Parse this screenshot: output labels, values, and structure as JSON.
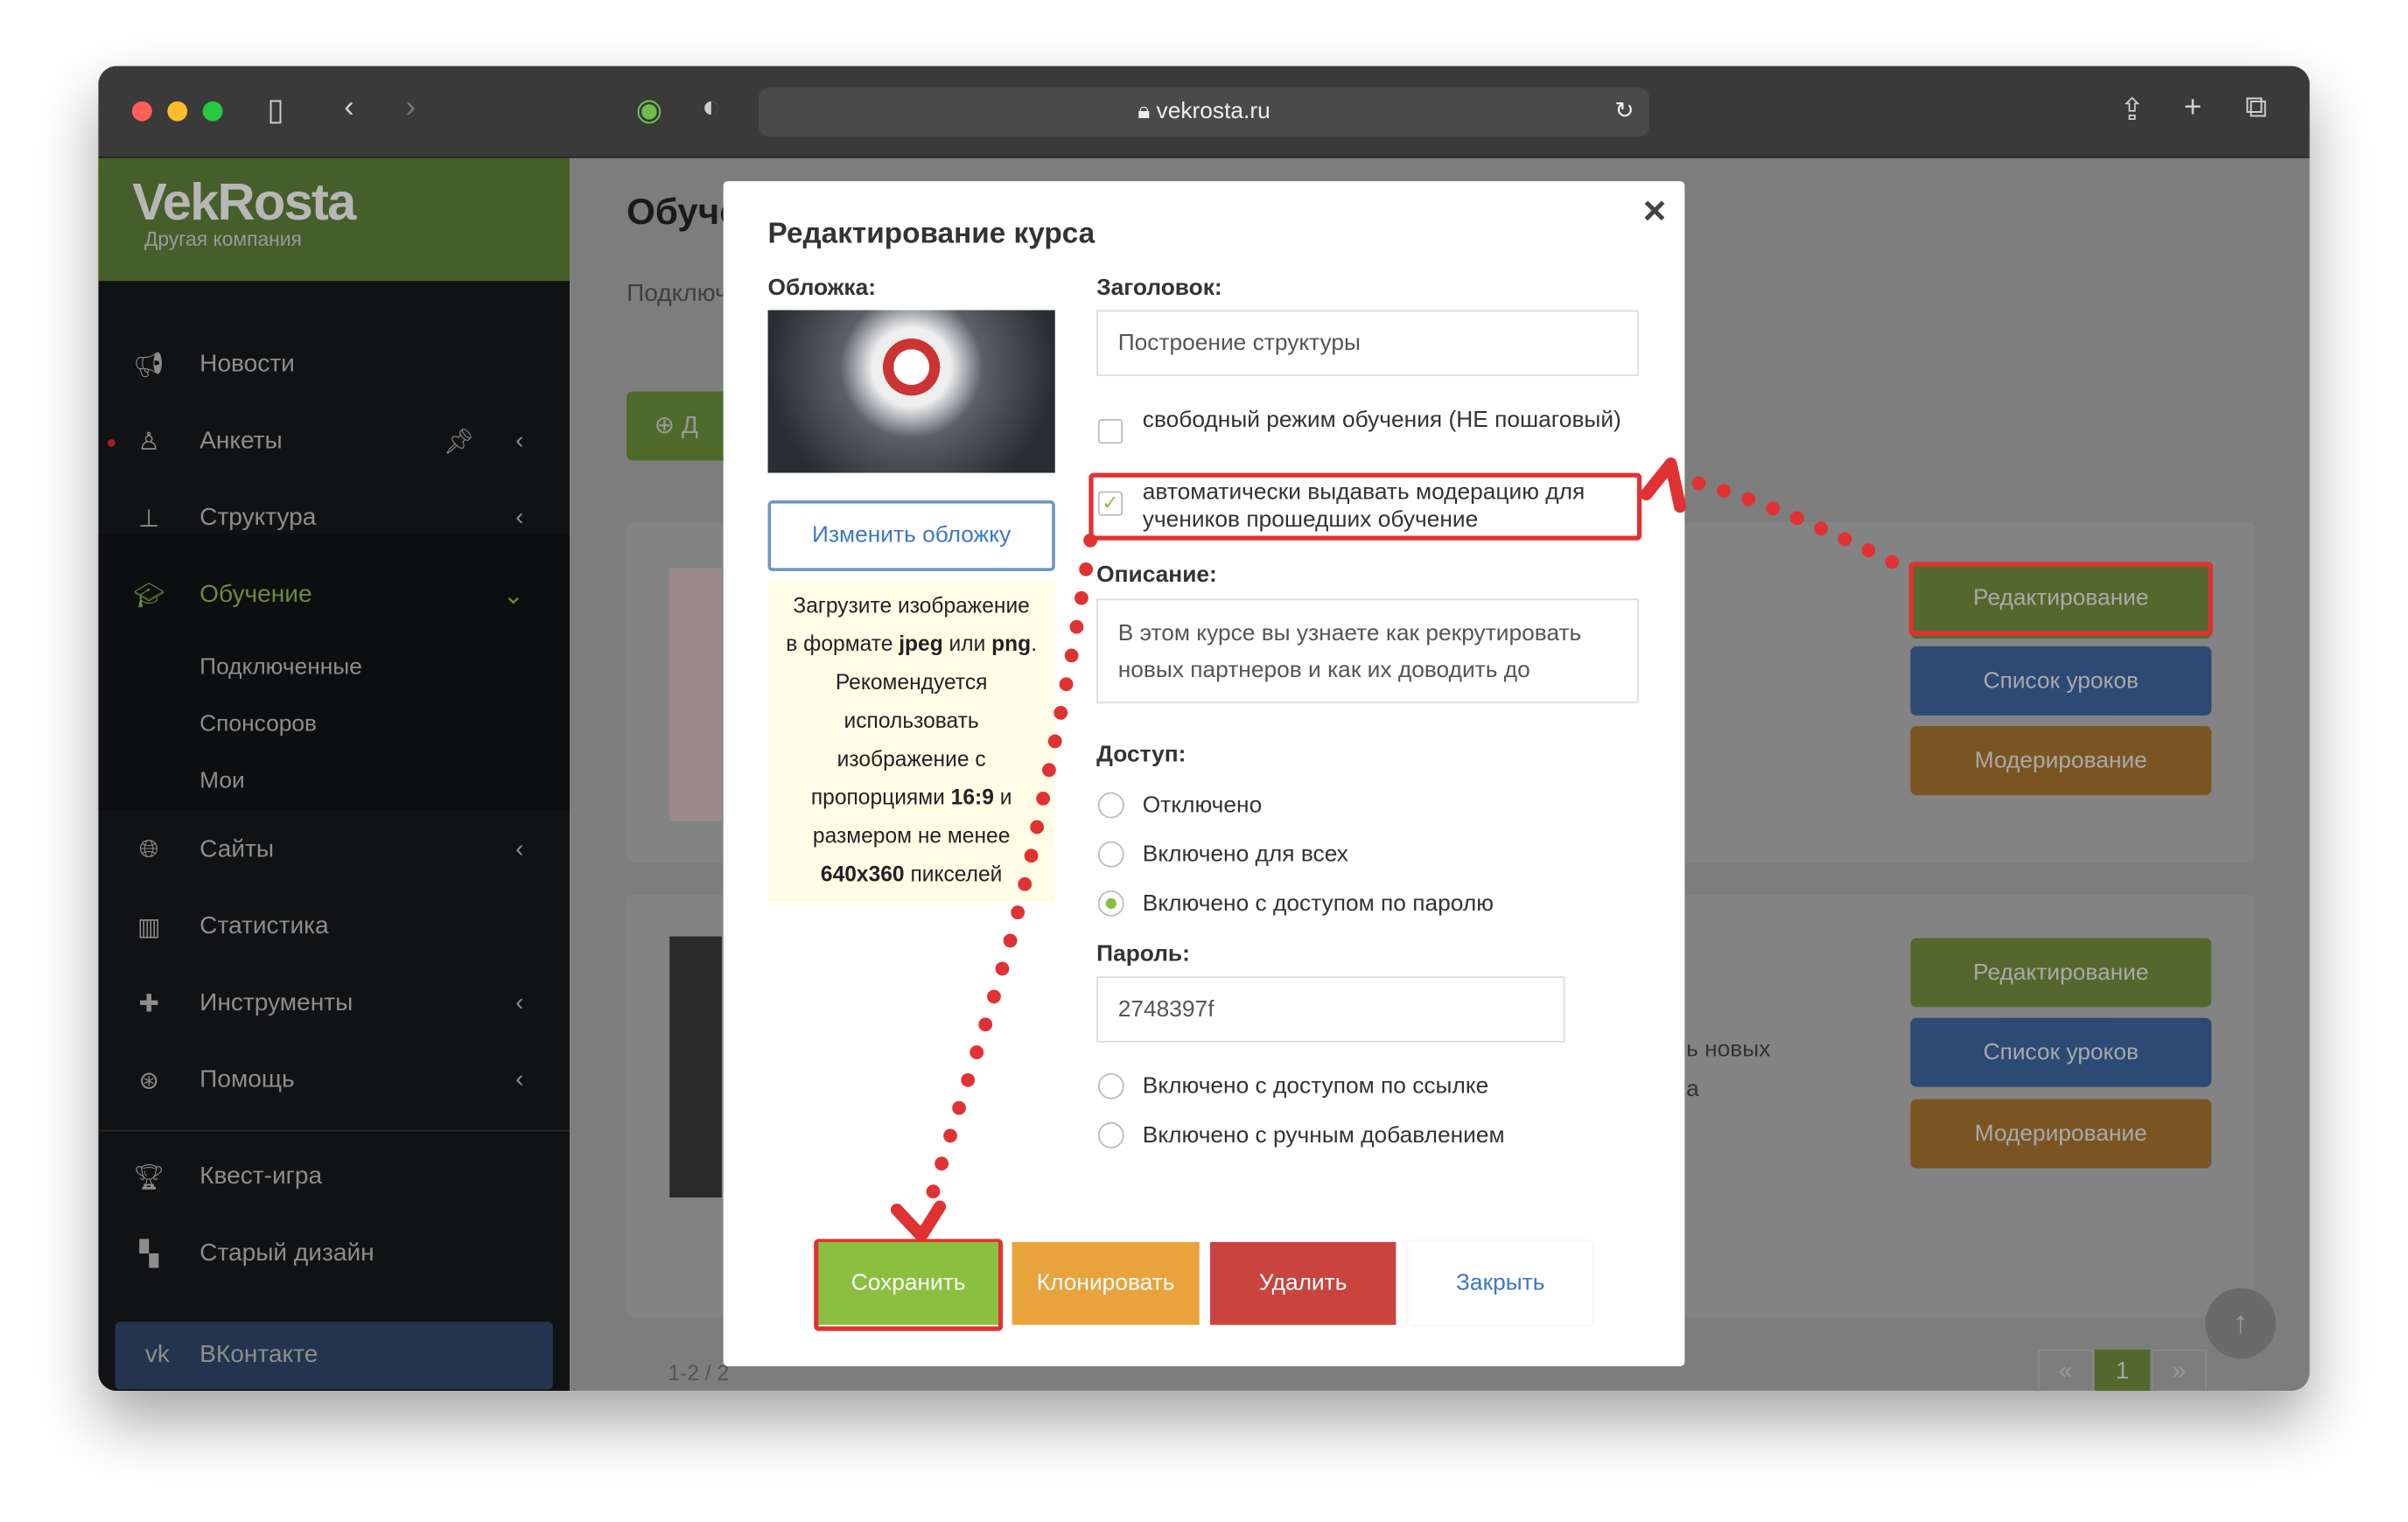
{
  "browser": {
    "url": "vekrosta.ru"
  },
  "logo": {
    "brand": "VekRosta",
    "subtitle": "Другая компания"
  },
  "sidebar": {
    "items": [
      {
        "label": "Новости",
        "icon": "megaphone-icon"
      },
      {
        "label": "Анкеты",
        "icon": "user-icon"
      },
      {
        "label": "Структура",
        "icon": "sitemap-icon"
      },
      {
        "label": "Обучение",
        "icon": "graduation-cap-icon",
        "active": true
      },
      {
        "label": "Сайты",
        "icon": "globe-icon"
      },
      {
        "label": "Статистика",
        "icon": "bar-chart-icon"
      },
      {
        "label": "Инструменты",
        "icon": "puzzle-icon"
      },
      {
        "label": "Помощь",
        "icon": "lifebuoy-icon"
      },
      {
        "label": "Квест-игра",
        "icon": "trophy-icon"
      },
      {
        "label": "Старый дизайн",
        "icon": "layout-icon"
      },
      {
        "label": "ВКонтакте",
        "icon": "vk-icon"
      }
    ],
    "subitems": [
      "Подключенные",
      "Спонсоров",
      "Мои"
    ]
  },
  "page": {
    "title": "Обучение",
    "tab": "Подключенные",
    "add_label": "Д",
    "card_text_1": "ь новых",
    "card_text_2": "а",
    "pagination_info": "1-2 / 2",
    "pages": [
      "«",
      "1",
      "»"
    ],
    "card_buttons": [
      "Редактирование",
      "Список уроков",
      "Модерирование"
    ]
  },
  "modal": {
    "title": "Редактирование курса",
    "cover_label": "Обложка:",
    "change_cover": "Изменить обложку",
    "hint": [
      "Загрузите изображение",
      "в формате ",
      "jpeg",
      " или ",
      "png",
      ".",
      "Рекомендуется",
      "использовать",
      "изображение с",
      "пропорциями ",
      "16:9",
      " и",
      "размером не менее",
      "640x360",
      " пикселей"
    ],
    "heading_label": "Заголовок:",
    "heading_value": "Построение структуры",
    "free_mode": "свободный режим обучения (НЕ пошаговый)",
    "free_mode_checked": false,
    "auto_moderation": "автоматически выдавать модерацию для учеников прошедших обучение",
    "auto_moderation_checked": true,
    "description_label": "Описание:",
    "description_value": "В этом курсе вы узнаете как рекрутировать новых партнеров и как их доводить до результата",
    "access_label": "Доступ:",
    "access_options": [
      "Отключено",
      "Включено для всех",
      "Включено с доступом по паролю",
      "Включено с доступом по ссылке",
      "Включено с ручным добавлением"
    ],
    "access_selected": "Включено с доступом по паролю",
    "password_label": "Пароль:",
    "password_value": "2748397f",
    "buttons": {
      "save": "Сохранить",
      "clone": "Клонировать",
      "delete": "Удалить",
      "close": "Закрыть"
    }
  },
  "colors": {
    "save": "#8bbf3f",
    "clone": "#e8a33d",
    "delete": "#c9443f",
    "annotation": "#e03232",
    "brand_green": "#465e2a"
  }
}
